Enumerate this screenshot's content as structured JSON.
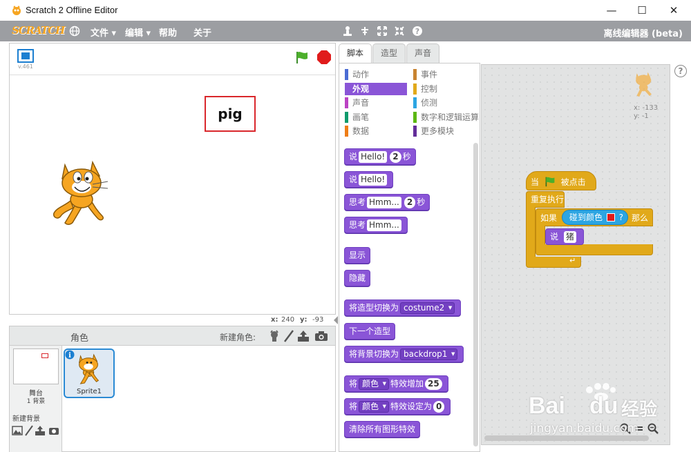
{
  "window": {
    "title": "Scratch 2 Offline Editor",
    "minimize": "—",
    "maximize": "☐",
    "close": "✕"
  },
  "menu": {
    "logo": "SCRATCH",
    "items": [
      "文件 ▾",
      "编辑 ▾",
      "帮助",
      "关于"
    ],
    "right_label": "离线编辑器 (beta)"
  },
  "stage": {
    "version": "v.461",
    "say_text": "pig",
    "coords": {
      "x_label": "x:",
      "x_value": "240",
      "y_label": "y:",
      "y_value": "-93"
    }
  },
  "sprites_panel": {
    "title": "角色",
    "new_sprite_label": "新建角色:",
    "stage_label": "舞台",
    "backdrop_count": "1 背景",
    "new_backdrop_label": "新建背景",
    "sprite_name": "Sprite1"
  },
  "tabs": [
    "脚本",
    "造型",
    "声音"
  ],
  "categories": {
    "left": [
      {
        "label": "动作",
        "color": "#4a6cd4"
      },
      {
        "label": "外观",
        "color": "#8a55d7"
      },
      {
        "label": "声音",
        "color": "#bb42c3"
      },
      {
        "label": "画笔",
        "color": "#0e9a6c"
      },
      {
        "label": "数据",
        "color": "#ee7d16"
      }
    ],
    "right": [
      {
        "label": "事件",
        "color": "#c88330"
      },
      {
        "label": "控制",
        "color": "#e1a91a"
      },
      {
        "label": "侦测",
        "color": "#2ca5e2"
      },
      {
        "label": "数字和逻辑运算",
        "color": "#5cb712"
      },
      {
        "label": "更多模块",
        "color": "#632d99"
      }
    ]
  },
  "blocks": {
    "say_for": {
      "a": "说",
      "input": "Hello!",
      "num": "2",
      "b": "秒"
    },
    "say": {
      "a": "说",
      "input": "Hello!"
    },
    "think_for": {
      "a": "思考",
      "input": "Hmm...",
      "num": "2",
      "b": "秒"
    },
    "think": {
      "a": "思考",
      "input": "Hmm..."
    },
    "show": "显示",
    "hide": "隐藏",
    "switch_costume": {
      "a": "将造型切换为",
      "dd": "costume2"
    },
    "next_costume": "下一个造型",
    "switch_backdrop": {
      "a": "将背景切换为",
      "dd": "backdrop1"
    },
    "change_effect": {
      "a": "将",
      "dd": "颜色",
      "b": "特效增加",
      "num": "25"
    },
    "set_effect": {
      "a": "将",
      "dd": "颜色",
      "b": "特效设定为",
      "num": "0"
    },
    "clear_effects": "清除所有图形特效"
  },
  "script_area": {
    "sprite_x": "x: -133",
    "sprite_y": "y: -1",
    "hat": {
      "a": "当",
      "b": "被点击"
    },
    "forever": "重复执行",
    "if": {
      "a": "如果",
      "b": "那么"
    },
    "touching": {
      "a": "碰到颜色",
      "b": "?"
    },
    "say": {
      "a": "说",
      "input": "猪"
    },
    "help": "?"
  },
  "watermark": {
    "brand": "Bai",
    "brand2": "du",
    "cn": "经验",
    "url": "jingyan.baidu.com"
  }
}
